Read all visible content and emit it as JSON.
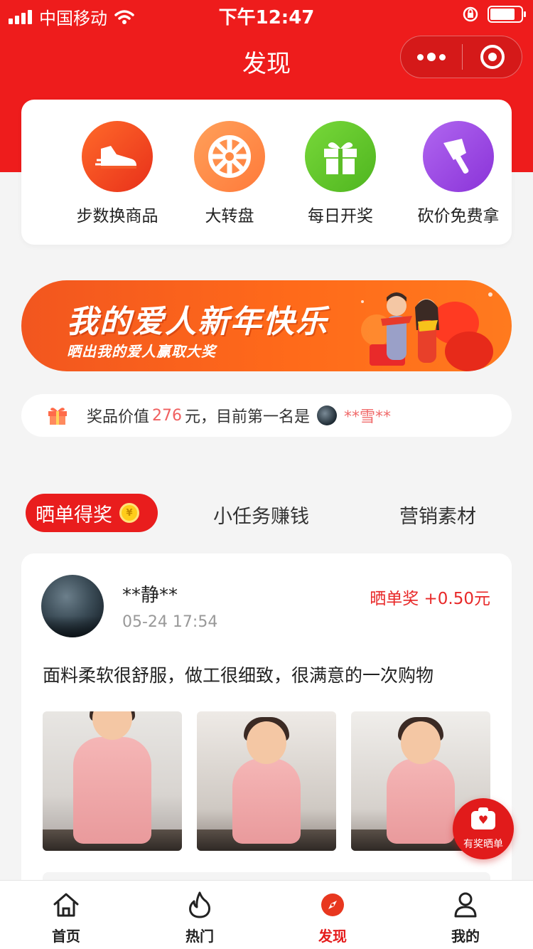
{
  "status_bar": {
    "carrier": "中国移动",
    "time": "下午12:47"
  },
  "nav": {
    "title": "发现"
  },
  "features": [
    {
      "label": "步数换商品",
      "icon": "shoe-icon",
      "color": "#f0461f"
    },
    {
      "label": "大转盘",
      "icon": "wheel-icon",
      "color": "#ff8a3d"
    },
    {
      "label": "每日开奖",
      "icon": "gift-icon",
      "color": "#62c52b"
    },
    {
      "label": "砍价免费拿",
      "icon": "axe-icon",
      "color": "#9a45e0"
    }
  ],
  "banner": {
    "title": "我的爱人新年快乐",
    "subtitle": "晒出我的爱人赢取大奖"
  },
  "prize_bar": {
    "prefix": "奖品价值",
    "value": "276",
    "suffix": "元，目前第一名是",
    "winner": "**雪**"
  },
  "tabs": {
    "active": "晒单得奖",
    "items": [
      "小任务赚钱",
      "营销素材"
    ]
  },
  "post": {
    "user": "**静**",
    "time": "05-24 17:54",
    "reward": "晒单奖 +0.50元",
    "text": "面料柔软很舒服，做工很细致，很满意的一次购物"
  },
  "fab": {
    "label": "有奖晒单"
  },
  "tabbar": [
    {
      "label": "首页",
      "icon": "home-icon"
    },
    {
      "label": "热门",
      "icon": "flame-icon"
    },
    {
      "label": "发现",
      "icon": "compass-icon",
      "active": true
    },
    {
      "label": "我的",
      "icon": "user-icon"
    }
  ],
  "colors": {
    "brand_red": "#ee1c1c",
    "accent_text": "#e82828"
  }
}
